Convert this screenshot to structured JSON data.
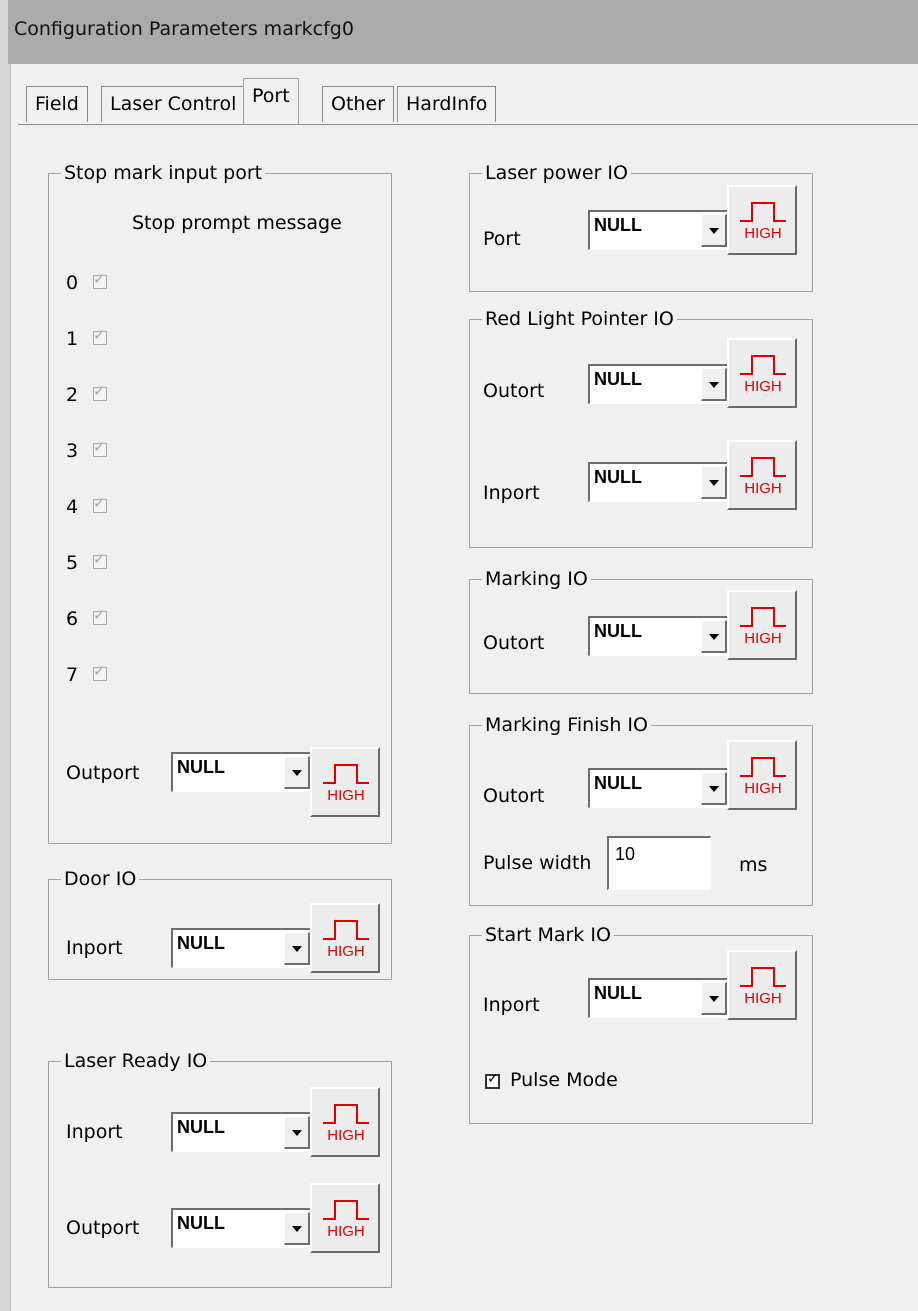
{
  "window": {
    "title": "Configuration Parameters markcfg0"
  },
  "tabs": [
    {
      "label": "Field"
    },
    {
      "label": "Laser Control"
    },
    {
      "label": "Port",
      "active": true
    },
    {
      "label": "Other"
    },
    {
      "label": "HardInfo"
    }
  ],
  "high_button": {
    "text": "HIGH",
    "color": "#e00000"
  },
  "stop_mark": {
    "legend": "Stop mark input port",
    "header": "Stop prompt message",
    "ports": [
      "0",
      "1",
      "2",
      "3",
      "4",
      "5",
      "6",
      "7"
    ],
    "outport_label": "Outport",
    "outport_value": "NULL"
  },
  "door_io": {
    "legend": "Door IO",
    "inport_label": "Inport",
    "inport_value": "NULL"
  },
  "laser_ready_io": {
    "legend": "Laser Ready IO",
    "inport_label": "Inport",
    "inport_value": "NULL",
    "outport_label": "Outport",
    "outport_value": "NULL"
  },
  "laser_power_io": {
    "legend": "Laser power IO",
    "port_label": "Port",
    "port_value": "NULL"
  },
  "red_light_io": {
    "legend": "Red Light Pointer IO",
    "outort_label": "Outort",
    "outort_value": "NULL",
    "inport_label": "Inport",
    "inport_value": "NULL"
  },
  "marking_io": {
    "legend": "Marking IO",
    "outort_label": "Outort",
    "outort_value": "NULL"
  },
  "marking_finish_io": {
    "legend": "Marking Finish IO",
    "outort_label": "Outort",
    "outort_value": "NULL",
    "pulse_label": "Pulse width",
    "pulse_value": "10",
    "pulse_unit": "ms"
  },
  "start_mark_io": {
    "legend": "Start Mark IO",
    "inport_label": "Inport",
    "inport_value": "NULL",
    "pulse_mode_label": "Pulse Mode",
    "pulse_mode_checked": true
  }
}
